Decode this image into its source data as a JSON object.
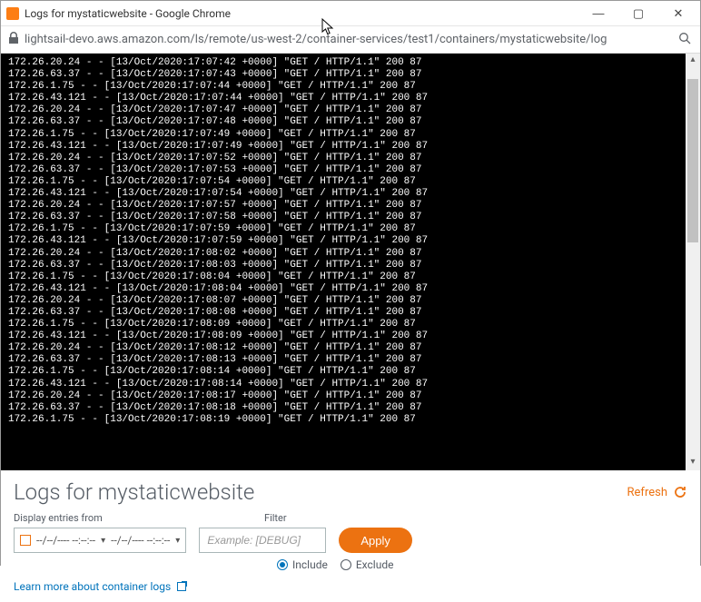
{
  "window": {
    "title": "Logs for mystaticwebsite - Google Chrome"
  },
  "address": {
    "url": "lightsail-devo.aws.amazon.com/ls/remote/us-west-2/container-services/test1/containers/mystaticwebsite/log"
  },
  "controls": {
    "page_title": "Logs for mystaticwebsite",
    "refresh_label": "Refresh",
    "display_label": "Display entries from",
    "filter_label": "Filter",
    "date_from_placeholder": "--/--/---- --:--:--",
    "date_to_placeholder": "--/--/---- --:--:--",
    "filter_placeholder": "Example: [DEBUG]",
    "apply_label": "Apply",
    "include_label": "Include",
    "exclude_label": "Exclude",
    "learn_more_label": "Learn more about container logs"
  },
  "logs": [
    "172.26.20.24 - - [13/Oct/2020:17:07:42 +0000] \"GET / HTTP/1.1\" 200 87",
    "172.26.63.37 - - [13/Oct/2020:17:07:43 +0000] \"GET / HTTP/1.1\" 200 87",
    "172.26.1.75 - - [13/Oct/2020:17:07:44 +0000] \"GET / HTTP/1.1\" 200 87",
    "172.26.43.121 - - [13/Oct/2020:17:07:44 +0000] \"GET / HTTP/1.1\" 200 87",
    "172.26.20.24 - - [13/Oct/2020:17:07:47 +0000] \"GET / HTTP/1.1\" 200 87",
    "172.26.63.37 - - [13/Oct/2020:17:07:48 +0000] \"GET / HTTP/1.1\" 200 87",
    "172.26.1.75 - - [13/Oct/2020:17:07:49 +0000] \"GET / HTTP/1.1\" 200 87",
    "172.26.43.121 - - [13/Oct/2020:17:07:49 +0000] \"GET / HTTP/1.1\" 200 87",
    "172.26.20.24 - - [13/Oct/2020:17:07:52 +0000] \"GET / HTTP/1.1\" 200 87",
    "172.26.63.37 - - [13/Oct/2020:17:07:53 +0000] \"GET / HTTP/1.1\" 200 87",
    "172.26.1.75 - - [13/Oct/2020:17:07:54 +0000] \"GET / HTTP/1.1\" 200 87",
    "172.26.43.121 - - [13/Oct/2020:17:07:54 +0000] \"GET / HTTP/1.1\" 200 87",
    "172.26.20.24 - - [13/Oct/2020:17:07:57 +0000] \"GET / HTTP/1.1\" 200 87",
    "172.26.63.37 - - [13/Oct/2020:17:07:58 +0000] \"GET / HTTP/1.1\" 200 87",
    "172.26.1.75 - - [13/Oct/2020:17:07:59 +0000] \"GET / HTTP/1.1\" 200 87",
    "172.26.43.121 - - [13/Oct/2020:17:07:59 +0000] \"GET / HTTP/1.1\" 200 87",
    "172.26.20.24 - - [13/Oct/2020:17:08:02 +0000] \"GET / HTTP/1.1\" 200 87",
    "172.26.63.37 - - [13/Oct/2020:17:08:03 +0000] \"GET / HTTP/1.1\" 200 87",
    "172.26.1.75 - - [13/Oct/2020:17:08:04 +0000] \"GET / HTTP/1.1\" 200 87",
    "172.26.43.121 - - [13/Oct/2020:17:08:04 +0000] \"GET / HTTP/1.1\" 200 87",
    "172.26.20.24 - - [13/Oct/2020:17:08:07 +0000] \"GET / HTTP/1.1\" 200 87",
    "172.26.63.37 - - [13/Oct/2020:17:08:08 +0000] \"GET / HTTP/1.1\" 200 87",
    "172.26.1.75 - - [13/Oct/2020:17:08:09 +0000] \"GET / HTTP/1.1\" 200 87",
    "172.26.43.121 - - [13/Oct/2020:17:08:09 +0000] \"GET / HTTP/1.1\" 200 87",
    "172.26.20.24 - - [13/Oct/2020:17:08:12 +0000] \"GET / HTTP/1.1\" 200 87",
    "172.26.63.37 - - [13/Oct/2020:17:08:13 +0000] \"GET / HTTP/1.1\" 200 87",
    "172.26.1.75 - - [13/Oct/2020:17:08:14 +0000] \"GET / HTTP/1.1\" 200 87",
    "172.26.43.121 - - [13/Oct/2020:17:08:14 +0000] \"GET / HTTP/1.1\" 200 87",
    "172.26.20.24 - - [13/Oct/2020:17:08:17 +0000] \"GET / HTTP/1.1\" 200 87",
    "172.26.63.37 - - [13/Oct/2020:17:08:18 +0000] \"GET / HTTP/1.1\" 200 87",
    "172.26.1.75 - - [13/Oct/2020:17:08:19 +0000] \"GET / HTTP/1.1\" 200 87"
  ]
}
